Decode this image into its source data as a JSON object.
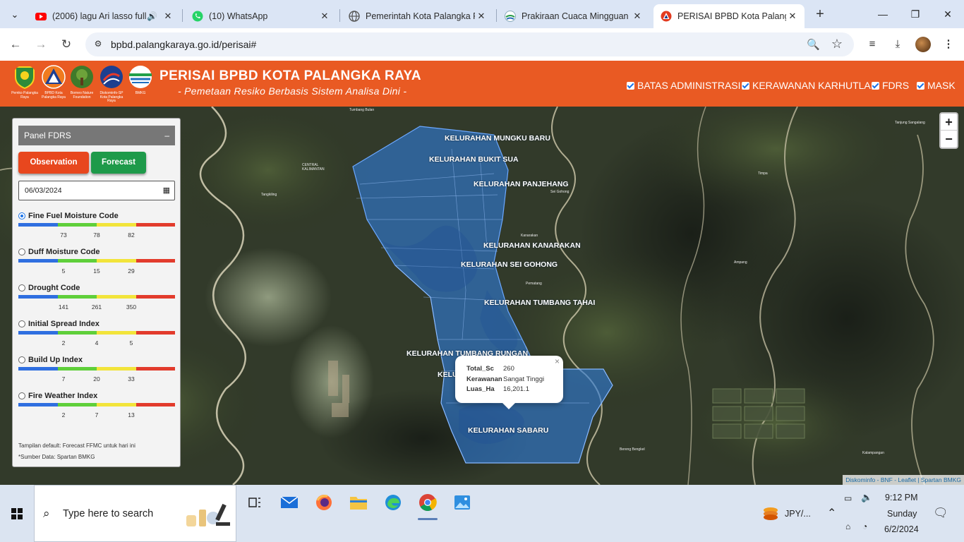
{
  "browser": {
    "tabs": [
      {
        "title": "(2006) lagu Ari lasso full",
        "icon": "youtube-icon",
        "audio": true
      },
      {
        "title": "(10) WhatsApp",
        "icon": "whatsapp-icon"
      },
      {
        "title": "Pemerintah Kota Palangka R",
        "icon": "globe-icon"
      },
      {
        "title": "Prakiraan Cuaca Mingguan |",
        "icon": "weather-icon"
      },
      {
        "title": "PERISAI BPBD Kota Palangka",
        "icon": "bpbd-icon",
        "active": true
      }
    ],
    "url": "bpbd.palangkaraya.go.id/perisai#"
  },
  "header": {
    "title": "PERISAI BPBD KOTA PALANGKA RAYA",
    "subtitle": "- Pemetaan Resiko Berbasis Sistem Analisa Dini -",
    "logos": [
      {
        "caption": "Pemko Palangka Raya"
      },
      {
        "caption": "BPBD Kota Palangka Raya"
      },
      {
        "caption": "Borneo Nature Foundation"
      },
      {
        "caption": "Diskominfo-SP Kota Palangka Raya"
      },
      {
        "caption": "BMKG"
      }
    ],
    "layers": [
      {
        "label": "BATAS ADMINISTRASI",
        "checked": true
      },
      {
        "label": "KERAWANAN KARHUTLA",
        "checked": true
      },
      {
        "label": "FDRS",
        "checked": true
      },
      {
        "label": "MASK",
        "checked": true
      }
    ]
  },
  "panel": {
    "title": "Panel FDRS",
    "collapse": "–",
    "observation": "Observation",
    "forecast": "Forecast",
    "date": "06/03/2024",
    "indices": [
      {
        "name": "Fine Fuel Moisture Code",
        "selected": true,
        "ticks": [
          "73",
          "78",
          "82"
        ]
      },
      {
        "name": "Duff Moisture Code",
        "selected": false,
        "ticks": [
          "5",
          "15",
          "29"
        ]
      },
      {
        "name": "Drought Code",
        "selected": false,
        "ticks": [
          "141",
          "261",
          "350"
        ]
      },
      {
        "name": "Initial Spread Index",
        "selected": false,
        "ticks": [
          "2",
          "4",
          "5"
        ]
      },
      {
        "name": "Build Up Index",
        "selected": false,
        "ticks": [
          "7",
          "20",
          "33"
        ]
      },
      {
        "name": "Fire Weather Index",
        "selected": false,
        "ticks": [
          "2",
          "7",
          "13"
        ]
      }
    ],
    "bar_colors": [
      "#2f6fe0",
      "#5fcf3a",
      "#f2e43a",
      "#e23b2c"
    ],
    "note1": "Tampilan default: Forecast FFMC untuk hari ini",
    "note2": "*Sumber Data: Spartan BMKG"
  },
  "map": {
    "kelurahan": [
      "KELURAHAN MUNGKU BARU",
      "KELURAHAN BUKIT SUA",
      "KELURAHAN PANJEHANG",
      "KELURAHAN KANARAKAN",
      "KELURAHAN SEI GOHONG",
      "KELURAHAN TUMBANG TAHAI",
      "KELURAHAN TUMBANG RUNGAN",
      "KELU",
      "KELURAHAN SABARU"
    ],
    "places": [
      "CENTRAL KALIMANTAN",
      "Tumbang Bulan",
      "Tangkiling",
      "Sei Gohong",
      "Kanarakan",
      "Pematang",
      "Timpa",
      "Ampang",
      "Tanjung Sangalang",
      "Bereng Bengkel",
      "Kalampangan"
    ],
    "popup": {
      "rows": [
        {
          "k": "Total_Sc",
          "v": "260"
        },
        {
          "k": "Kerawanan",
          "v": "Sangat Tinggi"
        },
        {
          "k": "Luas_Ha",
          "v": "16,201.1"
        }
      ],
      "close": "×"
    },
    "zoom_in": "+",
    "zoom_out": "−",
    "attribution": "Diskominfo - BNF - Leaflet | Spartan BMKG"
  },
  "taskbar": {
    "search_placeholder": "Type here to search",
    "apps": [
      "task-view-icon",
      "mail-icon",
      "firefox-icon",
      "file-explorer-icon",
      "edge-icon",
      "chrome-icon",
      "photos-icon"
    ],
    "weather": "JPY/...",
    "time": "9:12 PM",
    "day": "Sunday",
    "date": "6/2/2024"
  }
}
